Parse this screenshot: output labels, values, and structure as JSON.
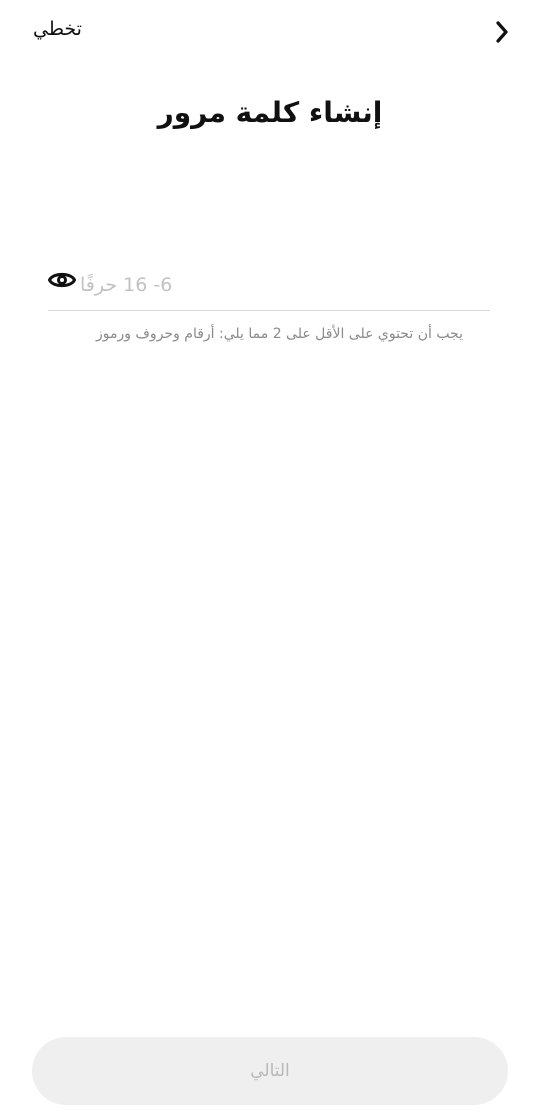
{
  "header": {
    "skip_label": "تخطي",
    "back_icon": "chevron-right-icon"
  },
  "title": "إنشاء كلمة مرور",
  "password": {
    "placeholder": "6- 16 حرفًا",
    "value": "",
    "visibility_icon": "eye-icon"
  },
  "hint": "يجب أن تحتوي على الأقل على 2 مما يلي: أرقام وحروف ورموز",
  "footer": {
    "next_label": "التالي",
    "next_enabled": false
  },
  "colors": {
    "background": "#ffffff",
    "text": "#111111",
    "hint": "#8a8a8a",
    "disabled_button_bg": "#efefef",
    "disabled_button_text": "#b9b9b9"
  }
}
